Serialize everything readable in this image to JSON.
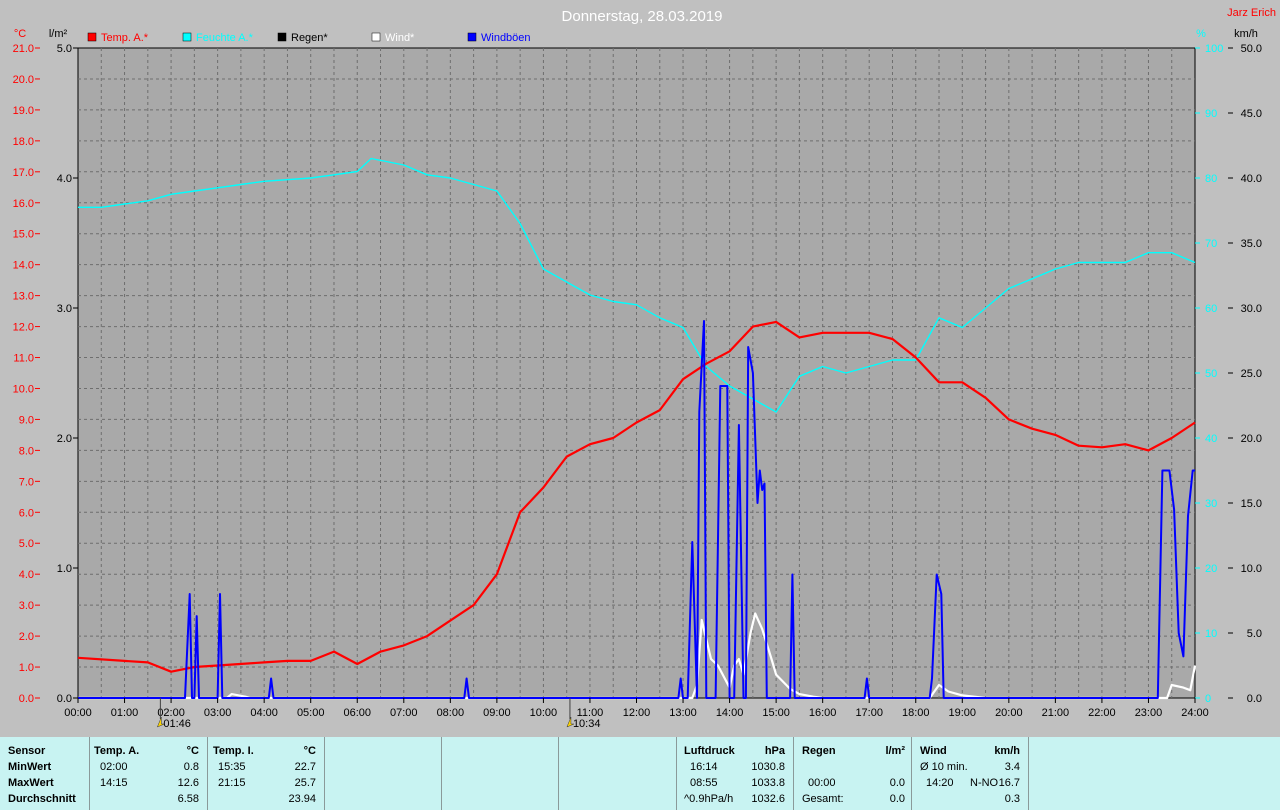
{
  "chart_data": {
    "type": "line",
    "title": "Donnerstag, 28.03.2019",
    "author": "Jarz Erich",
    "x_ticks": [
      "00:00",
      "01:00",
      "02:00",
      "03:00",
      "04:00",
      "05:00",
      "06:00",
      "07:00",
      "08:00",
      "09:00",
      "10:00",
      "11:00",
      "12:00",
      "13:00",
      "14:00",
      "15:00",
      "16:00",
      "17:00",
      "18:00",
      "19:00",
      "20:00",
      "21:00",
      "22:00",
      "23:00",
      "24:00"
    ],
    "x_range_hours": [
      0,
      24
    ],
    "grid": true,
    "axes": {
      "temp": {
        "unit": "°C",
        "range": [
          0,
          21
        ],
        "ticks": [
          "0.0",
          "1.0",
          "2.0",
          "3.0",
          "4.0",
          "5.0",
          "6.0",
          "7.0",
          "8.0",
          "9.0",
          "10.0",
          "11.0",
          "12.0",
          "13.0",
          "14.0",
          "15.0",
          "16.0",
          "17.0",
          "18.0",
          "19.0",
          "20.0",
          "21.0"
        ],
        "color": "#ff0000"
      },
      "rain": {
        "unit": "l/m²",
        "range": [
          0,
          5
        ],
        "ticks": [
          "0.0",
          "1.0",
          "2.0",
          "3.0",
          "4.0",
          "5.0"
        ],
        "color": "#000000"
      },
      "humidity": {
        "unit": "%",
        "range": [
          0,
          100
        ],
        "ticks": [
          "0",
          "10",
          "20",
          "30",
          "40",
          "50",
          "60",
          "70",
          "80",
          "90",
          "100"
        ],
        "color": "#00ffff"
      },
      "wind": {
        "unit": "km/h",
        "range": [
          0,
          50
        ],
        "ticks": [
          "0.0",
          "5.0",
          "10.0",
          "15.0",
          "20.0",
          "25.0",
          "30.0",
          "35.0",
          "40.0",
          "45.0",
          "50.0"
        ],
        "color": "#000000"
      }
    },
    "legend": [
      {
        "label": "Temp. A.*",
        "color": "#ff0000"
      },
      {
        "label": "Feuchte A.*",
        "color": "#00ffff"
      },
      {
        "label": "Regen*",
        "color": "#000000"
      },
      {
        "label": "Wind*",
        "color": "#ffffff"
      },
      {
        "label": "Windböen",
        "color": "#0000ff"
      }
    ],
    "markers": [
      {
        "time": 1.77,
        "label": "01:46"
      },
      {
        "time": 10.57,
        "label": "10:34"
      }
    ],
    "series": [
      {
        "name": "Temp. A.*",
        "axis": "temp",
        "color": "#ff0000",
        "points": [
          [
            0,
            1.3
          ],
          [
            1,
            1.2
          ],
          [
            1.5,
            1.15
          ],
          [
            2,
            0.85
          ],
          [
            2.5,
            1.0
          ],
          [
            3,
            1.05
          ],
          [
            4,
            1.15
          ],
          [
            4.5,
            1.2
          ],
          [
            5,
            1.2
          ],
          [
            5.5,
            1.5
          ],
          [
            6,
            1.1
          ],
          [
            6.5,
            1.5
          ],
          [
            7,
            1.7
          ],
          [
            7.5,
            2.0
          ],
          [
            8,
            2.5
          ],
          [
            8.5,
            3.0
          ],
          [
            9,
            4.0
          ],
          [
            9.5,
            6.0
          ],
          [
            10,
            6.8
          ],
          [
            10.5,
            7.8
          ],
          [
            11,
            8.2
          ],
          [
            11.5,
            8.4
          ],
          [
            12,
            8.9
          ],
          [
            12.5,
            9.3
          ],
          [
            13,
            10.3
          ],
          [
            13.5,
            10.8
          ],
          [
            14,
            11.2
          ],
          [
            14.5,
            12.0
          ],
          [
            15,
            12.15
          ],
          [
            15.5,
            11.65
          ],
          [
            16,
            11.8
          ],
          [
            16.5,
            11.8
          ],
          [
            17,
            11.8
          ],
          [
            17.5,
            11.6
          ],
          [
            18,
            11.0
          ],
          [
            18.5,
            10.2
          ],
          [
            19,
            10.2
          ],
          [
            19.5,
            9.7
          ],
          [
            20,
            9.0
          ],
          [
            20.5,
            8.7
          ],
          [
            21,
            8.5
          ],
          [
            21.5,
            8.15
          ],
          [
            22,
            8.1
          ],
          [
            22.5,
            8.2
          ],
          [
            23,
            8.0
          ],
          [
            23.5,
            8.4
          ],
          [
            24,
            8.9
          ]
        ]
      },
      {
        "name": "Feuchte A.*",
        "axis": "humidity",
        "color": "#00ffff",
        "points": [
          [
            0,
            75.5
          ],
          [
            0.5,
            75.5
          ],
          [
            1,
            76
          ],
          [
            1.5,
            76.5
          ],
          [
            2,
            77.5
          ],
          [
            2.5,
            78
          ],
          [
            3,
            78.5
          ],
          [
            3.5,
            79
          ],
          [
            4,
            79.5
          ],
          [
            5,
            80
          ],
          [
            5.5,
            80.5
          ],
          [
            6,
            81
          ],
          [
            6.3,
            83
          ],
          [
            7,
            82
          ],
          [
            7.5,
            80.5
          ],
          [
            8,
            80
          ],
          [
            8.5,
            79
          ],
          [
            9,
            78
          ],
          [
            9.5,
            73
          ],
          [
            10,
            66
          ],
          [
            10.5,
            64
          ],
          [
            11,
            62
          ],
          [
            11.5,
            61
          ],
          [
            12,
            60.5
          ],
          [
            12.5,
            58.5
          ],
          [
            13,
            57
          ],
          [
            13.5,
            51
          ],
          [
            14,
            48
          ],
          [
            14.5,
            46
          ],
          [
            15,
            44
          ],
          [
            15.5,
            49.5
          ],
          [
            16,
            51
          ],
          [
            16.5,
            50
          ],
          [
            17,
            51
          ],
          [
            17.5,
            52
          ],
          [
            18,
            52
          ],
          [
            18.5,
            58.5
          ],
          [
            19,
            57
          ],
          [
            19.5,
            60
          ],
          [
            20,
            63
          ],
          [
            20.5,
            64.5
          ],
          [
            21,
            66
          ],
          [
            21.5,
            67
          ],
          [
            22,
            67
          ],
          [
            22.5,
            67
          ],
          [
            23,
            68.5
          ],
          [
            23.5,
            68.5
          ],
          [
            24,
            67
          ]
        ]
      },
      {
        "name": "Wind*",
        "axis": "wind",
        "color": "#ffffff",
        "points": [
          [
            0,
            0
          ],
          [
            3.2,
            0
          ],
          [
            3.3,
            0.3
          ],
          [
            3.6,
            0.1
          ],
          [
            3.7,
            0
          ],
          [
            13.2,
            0
          ],
          [
            13.3,
            1
          ],
          [
            13.4,
            6
          ],
          [
            13.6,
            3
          ],
          [
            13.75,
            2.5
          ],
          [
            14.0,
            0.8
          ],
          [
            14.1,
            2.5
          ],
          [
            14.2,
            3
          ],
          [
            14.3,
            1.8
          ],
          [
            14.45,
            5
          ],
          [
            14.55,
            6.5
          ],
          [
            14.7,
            5.3
          ],
          [
            14.9,
            3
          ],
          [
            15.0,
            1.8
          ],
          [
            15.3,
            0.7
          ],
          [
            15.5,
            0.3
          ],
          [
            15.8,
            0.1
          ],
          [
            16.0,
            0
          ],
          [
            18.3,
            0
          ],
          [
            18.5,
            1
          ],
          [
            18.7,
            0.5
          ],
          [
            19.0,
            0.2
          ],
          [
            19.5,
            0
          ],
          [
            23.4,
            0
          ],
          [
            23.5,
            1
          ],
          [
            23.75,
            0.8
          ],
          [
            23.9,
            0.6
          ],
          [
            24,
            2.5
          ]
        ]
      },
      {
        "name": "Windböen",
        "axis": "wind",
        "color": "#0000ff",
        "points": [
          [
            0,
            0
          ],
          [
            2.3,
            0
          ],
          [
            2.4,
            8
          ],
          [
            2.45,
            0
          ],
          [
            2.5,
            0
          ],
          [
            2.55,
            6.3
          ],
          [
            2.6,
            0
          ],
          [
            3.0,
            0
          ],
          [
            3.05,
            8
          ],
          [
            3.1,
            0
          ],
          [
            4.1,
            0
          ],
          [
            4.15,
            1.5
          ],
          [
            4.2,
            0
          ],
          [
            8.3,
            0
          ],
          [
            8.35,
            1.5
          ],
          [
            8.4,
            0
          ],
          [
            12.9,
            0
          ],
          [
            12.95,
            1.5
          ],
          [
            13.0,
            0
          ],
          [
            13.1,
            0
          ],
          [
            13.2,
            12
          ],
          [
            13.3,
            0
          ],
          [
            13.35,
            22
          ],
          [
            13.45,
            29
          ],
          [
            13.5,
            0
          ],
          [
            13.6,
            0
          ],
          [
            13.7,
            0
          ],
          [
            13.8,
            24
          ],
          [
            13.95,
            24
          ],
          [
            14.0,
            0
          ],
          [
            14.1,
            0
          ],
          [
            14.2,
            21
          ],
          [
            14.3,
            0
          ],
          [
            14.35,
            0
          ],
          [
            14.4,
            27
          ],
          [
            14.5,
            25
          ],
          [
            14.6,
            15
          ],
          [
            14.65,
            17.5
          ],
          [
            14.7,
            16
          ],
          [
            14.75,
            16.5
          ],
          [
            14.8,
            0
          ],
          [
            15.3,
            0
          ],
          [
            15.35,
            9.5
          ],
          [
            15.4,
            0
          ],
          [
            16.9,
            0
          ],
          [
            16.95,
            1.5
          ],
          [
            17.0,
            0
          ],
          [
            18.3,
            0
          ],
          [
            18.35,
            1.5
          ],
          [
            18.45,
            9.5
          ],
          [
            18.55,
            8
          ],
          [
            18.6,
            0
          ],
          [
            23.2,
            0
          ],
          [
            23.3,
            17.5
          ],
          [
            23.45,
            17.5
          ],
          [
            23.55,
            14.5
          ],
          [
            23.65,
            5
          ],
          [
            23.75,
            3.2
          ],
          [
            23.85,
            14
          ],
          [
            23.95,
            17.5
          ],
          [
            24,
            17.5
          ]
        ]
      }
    ]
  },
  "stats": {
    "sensor": {
      "title": "Sensor",
      "rows": [
        "MinWert",
        "MaxWert",
        "Durchschnitt"
      ]
    },
    "temp_a": {
      "title": "Temp. A.",
      "unit": "°C",
      "min_time": "02:00",
      "min_val": "0.8",
      "max_time": "14:15",
      "max_val": "12.6",
      "avg": "6.58"
    },
    "temp_i": {
      "title": "Temp. I.",
      "unit": "°C",
      "min_time": "15:35",
      "min_val": "22.7",
      "max_time": "21:15",
      "max_val": "25.7",
      "avg": "23.94"
    },
    "luftdruck": {
      "title": "Luftdruck",
      "unit": "hPa",
      "min_time": "16:14",
      "min_val": "1030.8",
      "max_time": "08:55",
      "max_val": "1033.8",
      "trend": "^0.9hPa/h",
      "avg": "1032.6"
    },
    "regen": {
      "title": "Regen",
      "unit": "l/m²",
      "max_time": "00:00",
      "max_val": "0.0",
      "total_label": "Gesamt:",
      "total": "0.0"
    },
    "wind": {
      "title": "Wind",
      "unit": "km/h",
      "min_label": "Ø 10 min.",
      "min_val": "3.4",
      "max_time": "14:20",
      "max_dir": "N-NO",
      "max_val": "16.7",
      "avg": "0.3"
    }
  }
}
